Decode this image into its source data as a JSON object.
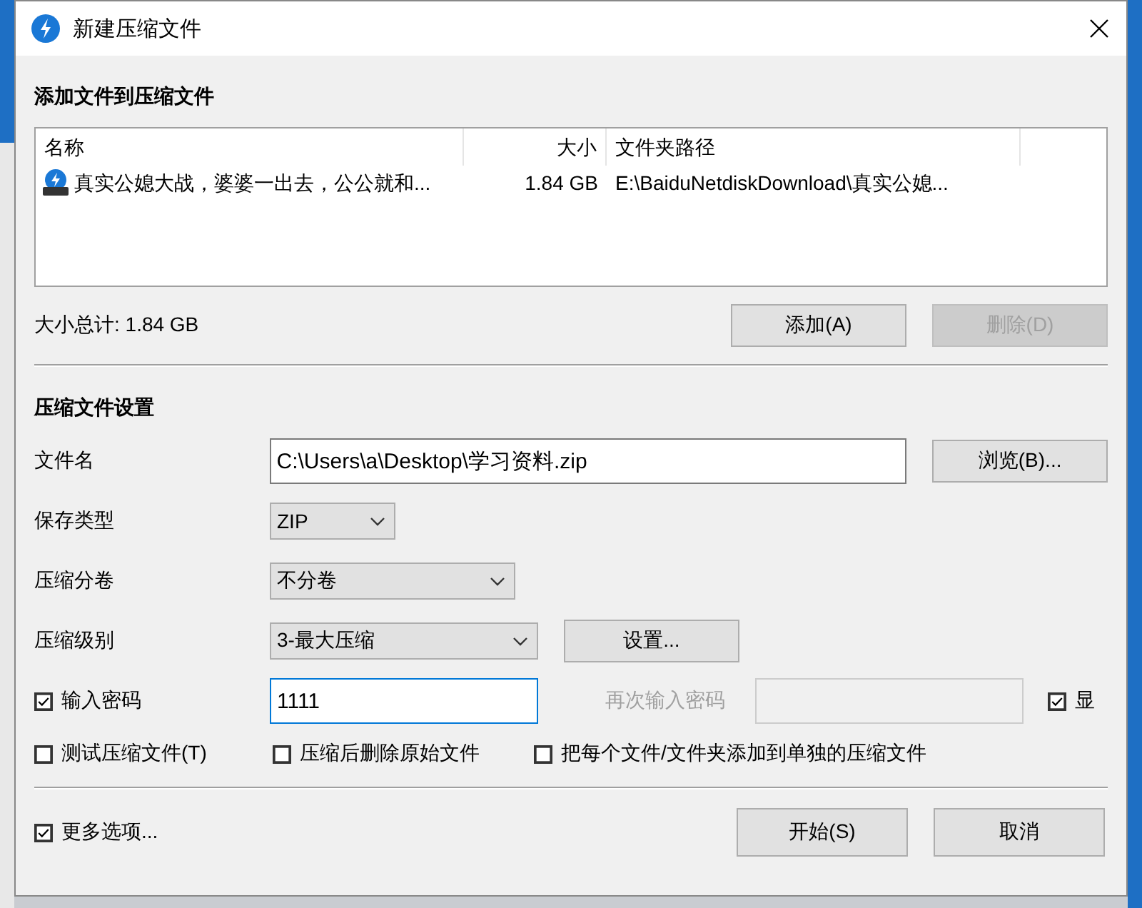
{
  "window": {
    "title": "新建压缩文件"
  },
  "files_section": {
    "heading": "添加文件到压缩文件",
    "columns": [
      "名称",
      "大小",
      "文件夹路径"
    ],
    "rows": [
      {
        "name": "真实公媳大战，婆婆一出去，公公就和...",
        "size": "1.84 GB",
        "path": "E:\\BaiduNetdiskDownload\\真实公媳..."
      }
    ],
    "total": "大小总计: 1.84 GB",
    "buttons": [
      {
        "label": "添加(A)",
        "disabled": false
      },
      {
        "label": "删除(D)",
        "disabled": true
      }
    ]
  },
  "settings_section": {
    "heading": "压缩文件设置",
    "filename": {
      "label": "文件名",
      "value": "C:\\Users\\a\\Desktop\\学习资料.zip",
      "button": "浏览(B)..."
    },
    "save_type": {
      "label": "保存类型",
      "value": "ZIP"
    },
    "split": {
      "label": "压缩分卷",
      "value": "不分卷"
    },
    "level": {
      "label": "压缩级别",
      "value": "3-最大压缩",
      "button": "设置..."
    },
    "password": {
      "label": "输入密码",
      "checked": true,
      "value": "1111",
      "confirm_label": "再次输入密码",
      "confirm_disabled": true,
      "show_label": "显",
      "show_checked": true
    },
    "options": [
      {
        "label": "测试压缩文件(T)",
        "checked": false
      },
      {
        "label": "压缩后删除原始文件",
        "checked": false
      },
      {
        "label": "把每个文件/文件夹添加到单独的压缩文件",
        "checked": false
      }
    ]
  },
  "footer": {
    "more": {
      "label": "更多选项...",
      "checked": true
    },
    "buttons": [
      "开始(S)",
      "取消"
    ]
  }
}
